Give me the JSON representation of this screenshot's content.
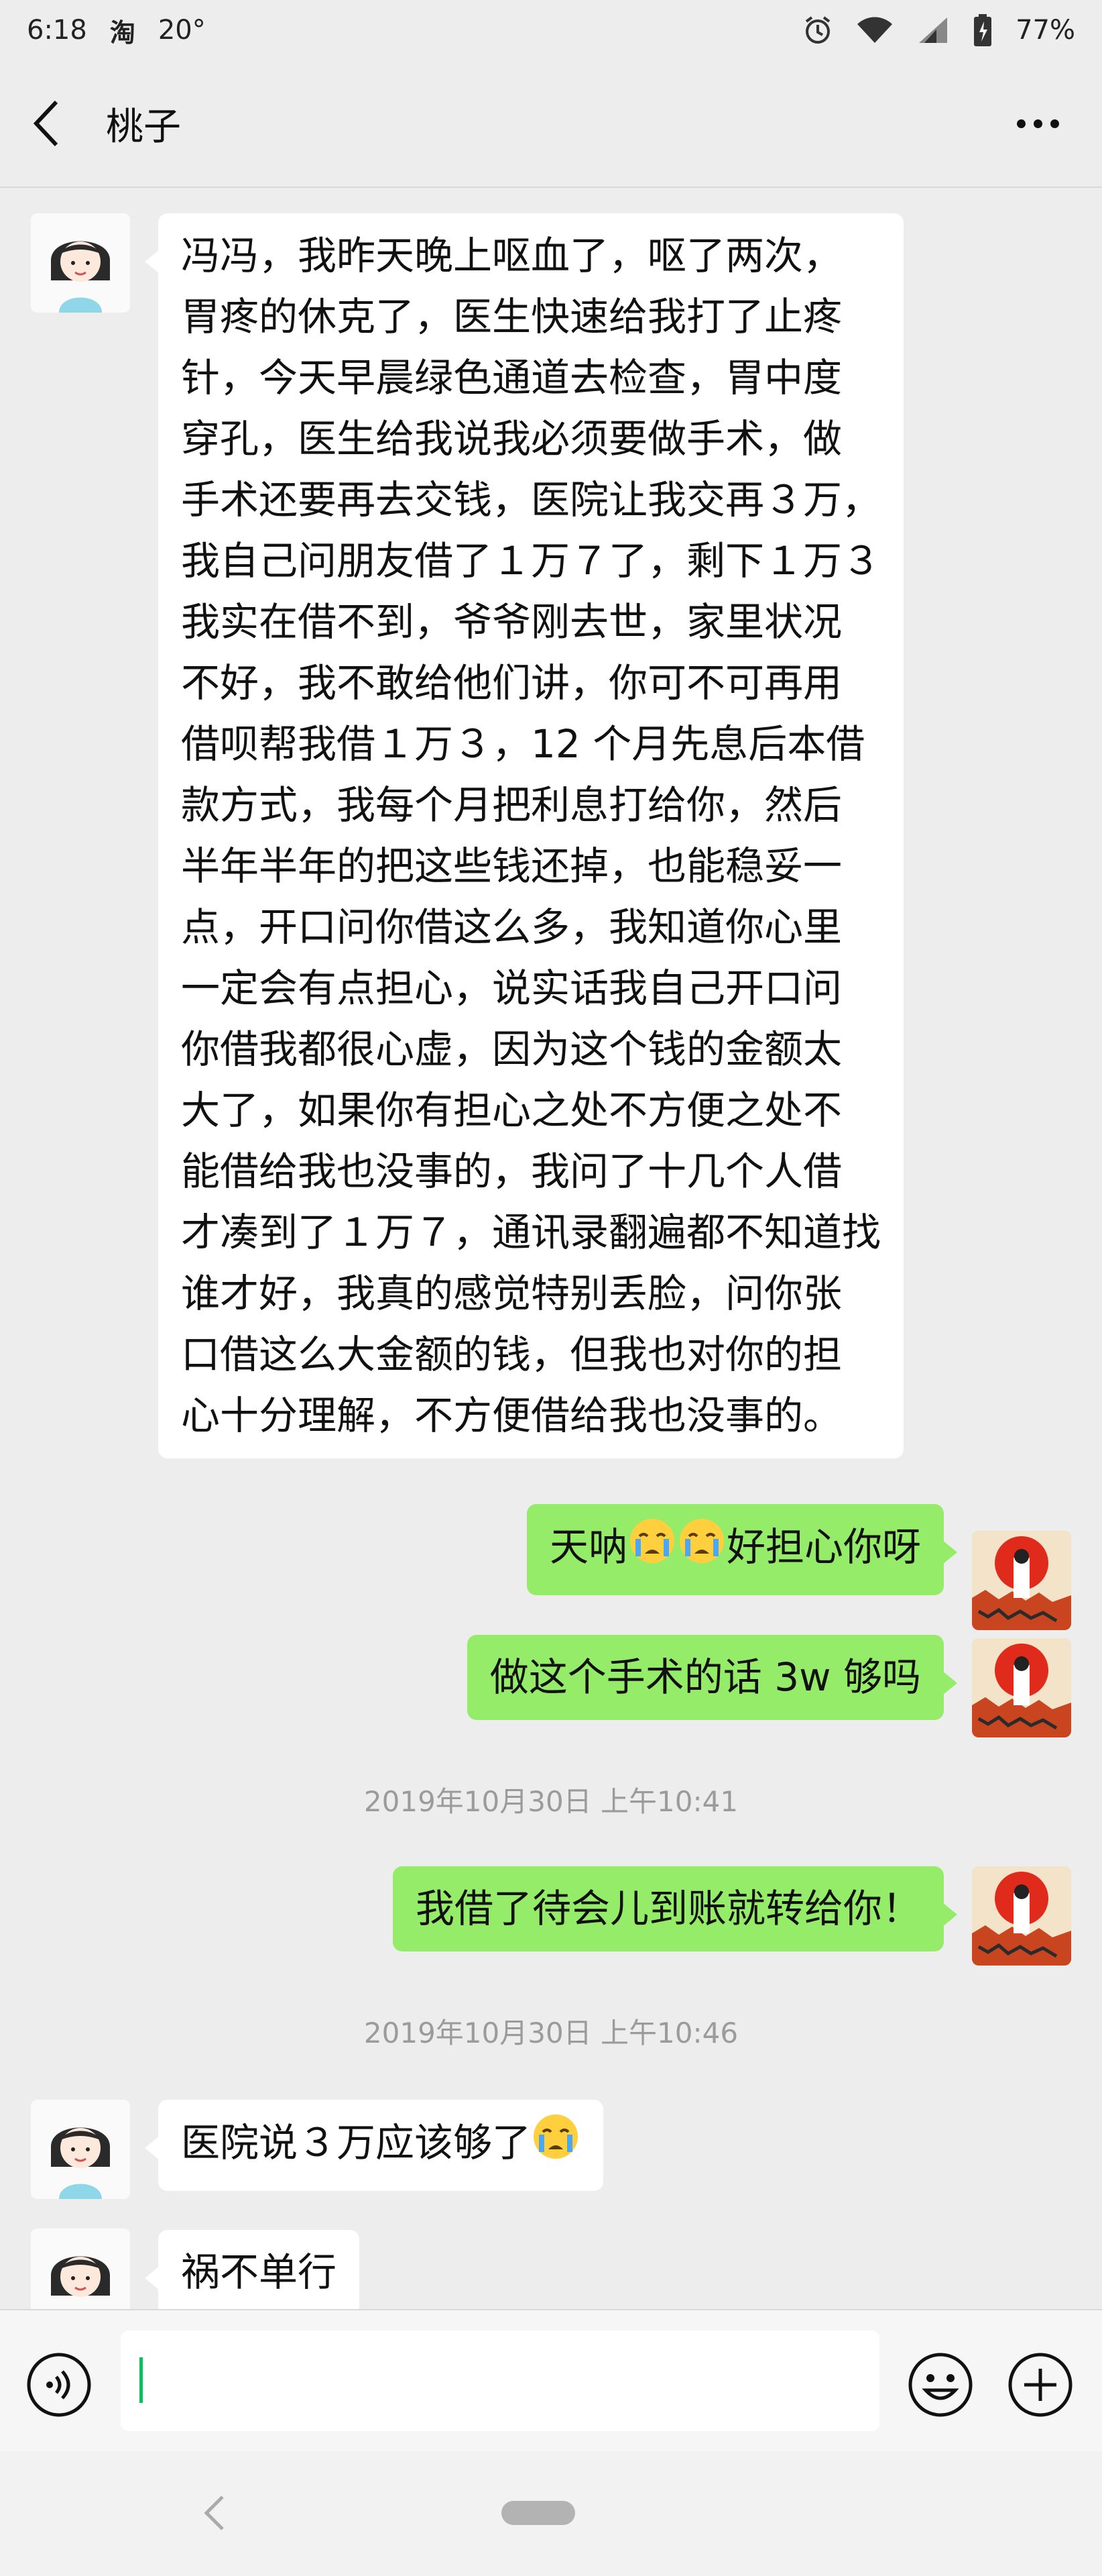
{
  "status_bar": {
    "time": "6:18",
    "app_glyph": "淘",
    "temperature": "20°",
    "battery": "77%",
    "icons": [
      "taobao-icon",
      "alarm-icon",
      "wifi-icon",
      "signal-icon",
      "battery-icon"
    ]
  },
  "nav": {
    "title": "桃子",
    "icons": [
      "back-chevron-icon",
      "more-dots-icon"
    ]
  },
  "messages": [
    {
      "from": "contact",
      "lines": [
        "冯冯，我昨天晚上呕血了，呕了两次，",
        "胃疼的休克了，医生快速给我打了止疼",
        "针，今天早晨绿色通道去检查，胃中度",
        "穿孔，医生给我说我必须要做手术，做",
        "手术还要再去交钱，医院让我交再３万，",
        "我自己问朋友借了１万７了，剩下１万３",
        "我实在借不到，爷爷刚去世，家里状况",
        "不好，我不敢给他们讲，你可不可再用",
        "借呗帮我借１万３，12 个月先息后本借",
        "款方式，我每个月把利息打给你，然后",
        "半年半年的把这些钱还掉，也能稳妥一",
        "点，开口问你借这么多，我知道你心里",
        "一定会有点担心，说实话我自己开口问",
        "你借我都很心虚，因为这个钱的金额太",
        "大了，如果你有担心之处不方便之处不",
        "能借给我也没事的，我问了十几个人借",
        "才凑到了１万７，通讯录翻遍都不知道找",
        "谁才好，我真的感觉特别丢脸，问你张",
        "口借这么大金额的钱，但我也对你的担",
        "心十分理解，不方便借给我也没事的。"
      ]
    },
    {
      "from": "me",
      "text_before": "天呐",
      "emoji_count": 2,
      "emoji_name": "crying-face-emoji",
      "text_after": "好担心你呀"
    },
    {
      "from": "me",
      "text": "做这个手术的话 3w 够吗"
    },
    {
      "type": "time",
      "text": "2019年10月30日 上午10:41"
    },
    {
      "from": "me",
      "text": "我借了待会儿到账就转给你！"
    },
    {
      "type": "time",
      "text": "2019年10月30日 上午10:46"
    },
    {
      "from": "contact",
      "text": "医院说３万应该够了",
      "emoji_name": "crying-face-emoji"
    },
    {
      "from": "contact",
      "text": "祸不单行"
    }
  ],
  "input_bar": {
    "icons": [
      "voice-icon",
      "emoji-icon",
      "plus-icon"
    ],
    "value": ""
  },
  "system_nav": {
    "icons": [
      "system-back-icon",
      "home-pill-icon"
    ]
  },
  "colors": {
    "background": "#ededed",
    "incoming_bubble": "#ffffff",
    "outgoing_bubble": "#95ec69",
    "timestamp_text": "#9b9b9b",
    "caret": "#07c160"
  }
}
